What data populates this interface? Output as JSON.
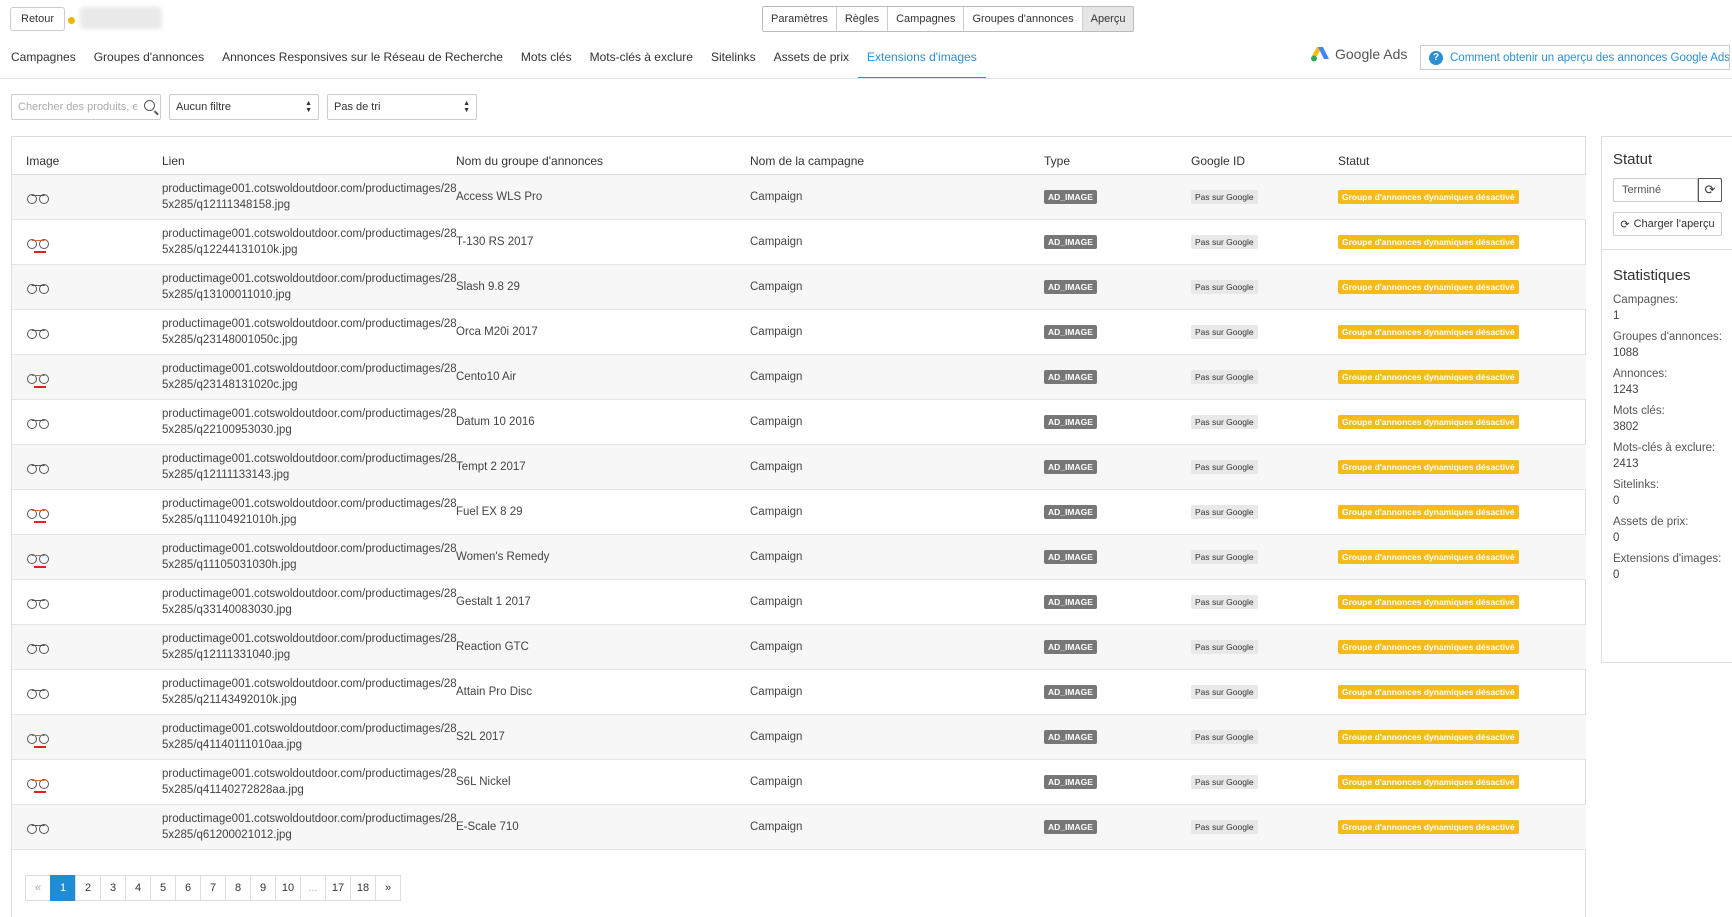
{
  "topbar": {
    "back_label": "Retour",
    "steps": [
      "Paramètres",
      "Règles",
      "Campagnes",
      "Groupes d'annonces",
      "Aperçu"
    ]
  },
  "tabs": [
    {
      "label": "Campagnes",
      "active": false
    },
    {
      "label": "Groupes d'annonces",
      "active": false
    },
    {
      "label": "Annonces Responsives sur le Réseau de Recherche",
      "active": false
    },
    {
      "label": "Mots clés",
      "active": false
    },
    {
      "label": "Mots-clés à exclure",
      "active": false
    },
    {
      "label": "Sitelinks",
      "active": false
    },
    {
      "label": "Assets de prix",
      "active": false
    },
    {
      "label": "Extensions d'images",
      "active": true
    }
  ],
  "google_ads_label": "Google Ads",
  "help_text": "Comment obtenir un aperçu des annonces Google Ads ?",
  "filters": {
    "search_placeholder": "Chercher des produits, ex",
    "filter_value": "Aucun filtre",
    "sort_value": "Pas de tri"
  },
  "table": {
    "columns": [
      "Image",
      "Lien",
      "Nom du groupe d'annonces",
      "Nom de la campagne",
      "Type",
      "Google ID",
      "Statut"
    ],
    "rows": [
      {
        "image": "bike-icon",
        "red": false,
        "link": "productimage001.cotswoldoutdoor.com/productimages/28\n5x285/q12111348158.jpg",
        "group": "Access WLS Pro",
        "campaign": "Campaign",
        "type": "AD_IMAGE",
        "gid": "Pas sur Google",
        "status": "Groupe d'annonces dynamiques désactivé"
      },
      {
        "image": "bike-icon",
        "red": true,
        "link": "productimage001.cotswoldoutdoor.com/productimages/28\n5x285/q12244131010k.jpg",
        "group": "T-130 RS 2017",
        "campaign": "Campaign",
        "type": "AD_IMAGE",
        "gid": "Pas sur Google",
        "status": "Groupe d'annonces dynamiques désactivé"
      },
      {
        "image": "bike-icon",
        "red": false,
        "link": "productimage001.cotswoldoutdoor.com/productimages/28\n5x285/q13100011010.jpg",
        "group": "Slash 9.8 29",
        "campaign": "Campaign",
        "type": "AD_IMAGE",
        "gid": "Pas sur Google",
        "status": "Groupe d'annonces dynamiques désactivé"
      },
      {
        "image": "bike-icon",
        "red": false,
        "link": "productimage001.cotswoldoutdoor.com/productimages/28\n5x285/q23148001050c.jpg",
        "group": "Orca M20i 2017",
        "campaign": "Campaign",
        "type": "AD_IMAGE",
        "gid": "Pas sur Google",
        "status": "Groupe d'annonces dynamiques désactivé"
      },
      {
        "image": "bike-icon",
        "red": true,
        "link": "productimage001.cotswoldoutdoor.com/productimages/28\n5x285/q23148131020c.jpg",
        "group": "Cento10 Air",
        "campaign": "Campaign",
        "type": "AD_IMAGE",
        "gid": "Pas sur Google",
        "status": "Groupe d'annonces dynamiques désactivé"
      },
      {
        "image": "bike-icon",
        "red": false,
        "link": "productimage001.cotswoldoutdoor.com/productimages/28\n5x285/q22100953030.jpg",
        "group": "Datum 10 2016",
        "campaign": "Campaign",
        "type": "AD_IMAGE",
        "gid": "Pas sur Google",
        "status": "Groupe d'annonces dynamiques désactivé"
      },
      {
        "image": "bike-icon",
        "red": false,
        "link": "productimage001.cotswoldoutdoor.com/productimages/28\n5x285/q12111133143.jpg",
        "group": "Tempt 2 2017",
        "campaign": "Campaign",
        "type": "AD_IMAGE",
        "gid": "Pas sur Google",
        "status": "Groupe d'annonces dynamiques désactivé"
      },
      {
        "image": "bike-icon",
        "red": true,
        "link": "productimage001.cotswoldoutdoor.com/productimages/28\n5x285/q11104921010h.jpg",
        "group": "Fuel EX 8 29",
        "campaign": "Campaign",
        "type": "AD_IMAGE",
        "gid": "Pas sur Google",
        "status": "Groupe d'annonces dynamiques désactivé"
      },
      {
        "image": "bike-icon",
        "red": true,
        "link": "productimage001.cotswoldoutdoor.com/productimages/28\n5x285/q11105031030h.jpg",
        "group": "Women's Remedy",
        "campaign": "Campaign",
        "type": "AD_IMAGE",
        "gid": "Pas sur Google",
        "status": "Groupe d'annonces dynamiques désactivé"
      },
      {
        "image": "bike-icon",
        "red": false,
        "link": "productimage001.cotswoldoutdoor.com/productimages/28\n5x285/q33140083030.jpg",
        "group": "Gestalt 1 2017",
        "campaign": "Campaign",
        "type": "AD_IMAGE",
        "gid": "Pas sur Google",
        "status": "Groupe d'annonces dynamiques désactivé"
      },
      {
        "image": "bike-icon",
        "red": false,
        "link": "productimage001.cotswoldoutdoor.com/productimages/28\n5x285/q12111331040.jpg",
        "group": "Reaction GTC",
        "campaign": "Campaign",
        "type": "AD_IMAGE",
        "gid": "Pas sur Google",
        "status": "Groupe d'annonces dynamiques désactivé"
      },
      {
        "image": "bike-icon",
        "red": false,
        "link": "productimage001.cotswoldoutdoor.com/productimages/28\n5x285/q21143492010k.jpg",
        "group": "Attain Pro Disc",
        "campaign": "Campaign",
        "type": "AD_IMAGE",
        "gid": "Pas sur Google",
        "status": "Groupe d'annonces dynamiques désactivé"
      },
      {
        "image": "bike-icon",
        "red": true,
        "link": "productimage001.cotswoldoutdoor.com/productimages/28\n5x285/q41140111010aa.jpg",
        "group": "S2L 2017",
        "campaign": "Campaign",
        "type": "AD_IMAGE",
        "gid": "Pas sur Google",
        "status": "Groupe d'annonces dynamiques désactivé"
      },
      {
        "image": "bike-icon",
        "red": true,
        "link": "productimage001.cotswoldoutdoor.com/productimages/28\n5x285/q41140272828aa.jpg",
        "group": "S6L Nickel",
        "campaign": "Campaign",
        "type": "AD_IMAGE",
        "gid": "Pas sur Google",
        "status": "Groupe d'annonces dynamiques désactivé"
      },
      {
        "image": "bike-icon",
        "red": false,
        "link": "productimage001.cotswoldoutdoor.com/productimages/28\n5x285/q61200021012.jpg",
        "group": "E-Scale 710",
        "campaign": "Campaign",
        "type": "AD_IMAGE",
        "gid": "Pas sur Google",
        "status": "Groupe d'annonces dynamiques désactivé"
      }
    ]
  },
  "pagination": {
    "pages": [
      "«",
      "1",
      "2",
      "3",
      "4",
      "5",
      "6",
      "7",
      "8",
      "9",
      "10",
      "...",
      "17",
      "18",
      "»"
    ],
    "current": "1"
  },
  "side": {
    "status_title": "Statut",
    "status_value": "Terminé",
    "load_label": "Charger l'aperçu",
    "stats_title": "Statistiques",
    "stats": [
      {
        "label": "Campagnes:",
        "value": "1"
      },
      {
        "label": "Groupes d'annonces:",
        "value": "1088"
      },
      {
        "label": "Annonces:",
        "value": "1243"
      },
      {
        "label": "Mots clés:",
        "value": "3802"
      },
      {
        "label": "Mots-clés à exclure:",
        "value": "2413"
      },
      {
        "label": "Sitelinks:",
        "value": "0"
      },
      {
        "label": "Assets de prix:",
        "value": "0"
      },
      {
        "label": "Extensions d'images:",
        "value": "0"
      }
    ]
  },
  "colors": {
    "accent": "#2b8fd6",
    "status_badge": "#f4bb1a",
    "type_badge": "#777777",
    "pending_dot": "#f0b400"
  }
}
